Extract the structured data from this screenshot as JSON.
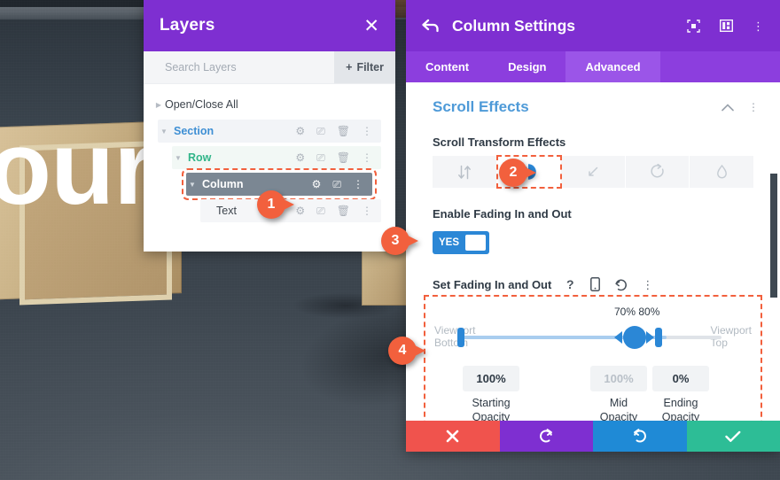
{
  "background": {
    "hero_text": "our"
  },
  "layers_panel": {
    "title": "Layers",
    "close_icon": "close-x-icon",
    "search": {
      "placeholder": "Search Layers"
    },
    "filter_button": {
      "label": "Filter",
      "icon": "plus-icon"
    },
    "open_close_all": "Open/Close All",
    "rows": [
      {
        "label": "Section",
        "actions": [
          "gear-icon",
          "duplicate-icon",
          "trash-icon",
          "more-icon"
        ]
      },
      {
        "label": "Row",
        "actions": [
          "gear-icon",
          "duplicate-icon",
          "trash-icon",
          "more-icon"
        ]
      },
      {
        "label": "Column",
        "actions": [
          "gear-icon",
          "duplicate-icon",
          "more-icon"
        ]
      },
      {
        "label": "Text",
        "actions": [
          "gear-icon",
          "duplicate-icon",
          "trash-icon",
          "more-icon"
        ]
      }
    ]
  },
  "column_settings": {
    "title": "Column Settings",
    "back_icon": "back-arrow-icon",
    "header_icons": [
      "fullscreen-icon",
      "layout-view-icon",
      "more-vertical-icon"
    ],
    "tabs": [
      {
        "label": "Content",
        "active": false
      },
      {
        "label": "Design",
        "active": false
      },
      {
        "label": "Advanced",
        "active": true
      }
    ],
    "scroll_effects": {
      "title": "Scroll Effects",
      "collapse_icon": "chevron-up-icon",
      "more_icon": "more-vertical-icon"
    },
    "transform_effects": {
      "label": "Scroll Transform Effects",
      "options": [
        {
          "name": "vertical-motion-icon",
          "active": false
        },
        {
          "name": "fade-icon",
          "active": true
        },
        {
          "name": "scale-icon",
          "active": false
        },
        {
          "name": "rotate-icon",
          "active": false
        },
        {
          "name": "blur-icon",
          "active": false
        }
      ]
    },
    "enable_fading": {
      "label": "Enable Fading In and Out",
      "toggle_value": "YES"
    },
    "set_fading": {
      "label": "Set Fading In and Out",
      "icons": [
        "help-icon",
        "mobile-icon",
        "reset-icon",
        "more-vertical-icon"
      ],
      "range_labels": "70% 80%",
      "viewport_bottom": "Viewport\nBottom",
      "viewport_bottom_line1": "Viewport",
      "viewport_bottom_line2": "Bottom",
      "viewport_top_line1": "Viewport",
      "viewport_top_line2": "Top",
      "opacities": [
        {
          "value": "100%",
          "caption_line1": "Starting",
          "caption_line2": "Opacity",
          "disabled": false
        },
        {
          "value": "100%",
          "caption_line1": "Mid",
          "caption_line2": "Opacity",
          "disabled": true
        },
        {
          "value": "0%",
          "caption_line1": "Ending",
          "caption_line2": "Opacity",
          "disabled": false
        }
      ]
    }
  },
  "action_bar": [
    {
      "name": "cancel-button",
      "icon": "x-icon",
      "color": "#f0534d"
    },
    {
      "name": "undo-button",
      "icon": "undo-icon",
      "color": "#7e2fd1"
    },
    {
      "name": "redo-button",
      "icon": "redo-icon",
      "color": "#1f8ad6"
    },
    {
      "name": "save-button",
      "icon": "check-icon",
      "color": "#2dbd96"
    }
  ],
  "step_markers": [
    {
      "number": "1"
    },
    {
      "number": "2"
    },
    {
      "number": "3"
    },
    {
      "number": "4"
    }
  ],
  "colors": {
    "purple_header": "#7e2fd1",
    "purple_tabs": "#8c3ede",
    "accent_blue": "#2b87d6",
    "marker_orange": "#f2603d",
    "section_blue": "#3e8fd4",
    "row_green": "#31b589"
  }
}
